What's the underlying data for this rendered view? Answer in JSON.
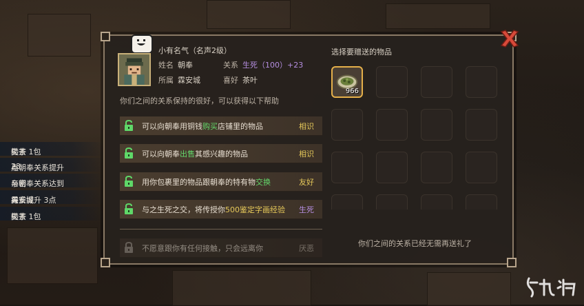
{
  "npc": {
    "title": "小有名气（名声2级）",
    "name_label": "姓名",
    "name": "朝奉",
    "relation_label": "关系",
    "relation": "生死（100）+23",
    "faction_label": "所属",
    "faction": "霖安城",
    "likes_label": "喜好",
    "likes": "茶叶",
    "summary": "你们之间的关系保持的很好，可以获得以下帮助"
  },
  "benefits": [
    {
      "pre": "可以向朝奉用铜钱",
      "hl": "购买",
      "post": "店铺里的物品",
      "level": "相识",
      "state": "unlocked"
    },
    {
      "pre": "可以向朝奉",
      "hl": "出售",
      "post": "其感兴趣的物品",
      "level": "相识",
      "state": "unlocked"
    },
    {
      "pre": "用你包裹里的物品跟朝奉的特有物",
      "hl": "交换",
      "post": "",
      "level": "友好",
      "state": "unlocked"
    },
    {
      "pre": "与之生死之交，将传授你",
      "hl": "500鉴定字画经验",
      "post": "",
      "level": "生死",
      "state": "unlocked"
    },
    {
      "pre": "不愿意跟你有任何接触，只会远离你",
      "hl": "",
      "post": "",
      "level": "厌恶",
      "state": "locked"
    }
  ],
  "gift": {
    "title": "选择要赠送的物品",
    "selected_count": "966",
    "message": "你们之间的关系已经无需再送礼了"
  },
  "log": [
    {
      "a": "失去 1包",
      "b": "糙茶",
      "c": "",
      "hl": "yellow"
    },
    {
      "a": "与朝奉关系提升",
      "b": "23",
      "c": "点",
      "hl": "yellow"
    },
    {
      "a": "与朝奉关系达到",
      "b": "亲密",
      "c": "",
      "hl": "blue"
    },
    {
      "a": "与",
      "b": "霖安城",
      "c": "关系提升 3点",
      "hl": "yellow"
    },
    {
      "a": "失去 1包",
      "b": "糙茶",
      "c": "",
      "hl": "yellow"
    }
  ],
  "colors": {
    "accent": "#e6b04a",
    "close": "#d84a3a",
    "green": "#64d86c",
    "purple": "#b58ee0"
  }
}
